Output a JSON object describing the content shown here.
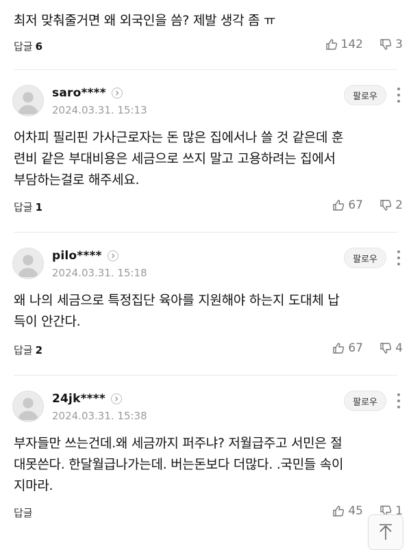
{
  "top_comment": {
    "text": "최저 맞춰줄거면 왜 외국인을 씀? 제발 생각 좀 ㅠ",
    "reply_label": "답글",
    "reply_count": "6",
    "likes": "142",
    "dislikes": "3"
  },
  "comments": [
    {
      "username": "saro****",
      "date": "2024.03.31. 15:13",
      "follow_label": "팔로우",
      "lines": [
        "어차피 필리핀 가사근로자는 돈 많은 집에서나 쓸 것 같은데 훈",
        "련비 같은 부대비용은 세금으로 쓰지 말고 고용하려는 집에서",
        "부담하는걸로 해주세요."
      ],
      "reply_label": "답글",
      "reply_count": "1",
      "likes": "67",
      "dislikes": "2"
    },
    {
      "username": "pilo****",
      "date": "2024.03.31. 15:18",
      "follow_label": "팔로우",
      "lines": [
        "왜 나의 세금으로 특정집단 육아를 지원해야 하는지 도대체 납",
        "득이 안간다."
      ],
      "reply_label": "답글",
      "reply_count": "2",
      "likes": "67",
      "dislikes": "4"
    },
    {
      "username": "24jk****",
      "date": "2024.03.31. 15:38",
      "follow_label": "팔로우",
      "lines": [
        "부자들만 쓰는건데.왜 세금까지 퍼주냐? 저월급주고 서민은 절",
        "대못쓴다. 한달월급나가는데. 버는돈보다 더많다. .국민들 속이",
        "지마라."
      ],
      "reply_label": "답글",
      "reply_count": "",
      "likes": "45",
      "dislikes": "1"
    }
  ],
  "icons": {
    "like": "thumbs-up-icon",
    "dislike": "thumbs-down-icon",
    "more": "more-vertical-icon",
    "profile_arrow": "chevron-right-icon",
    "scroll_top": "arrow-up-icon"
  }
}
